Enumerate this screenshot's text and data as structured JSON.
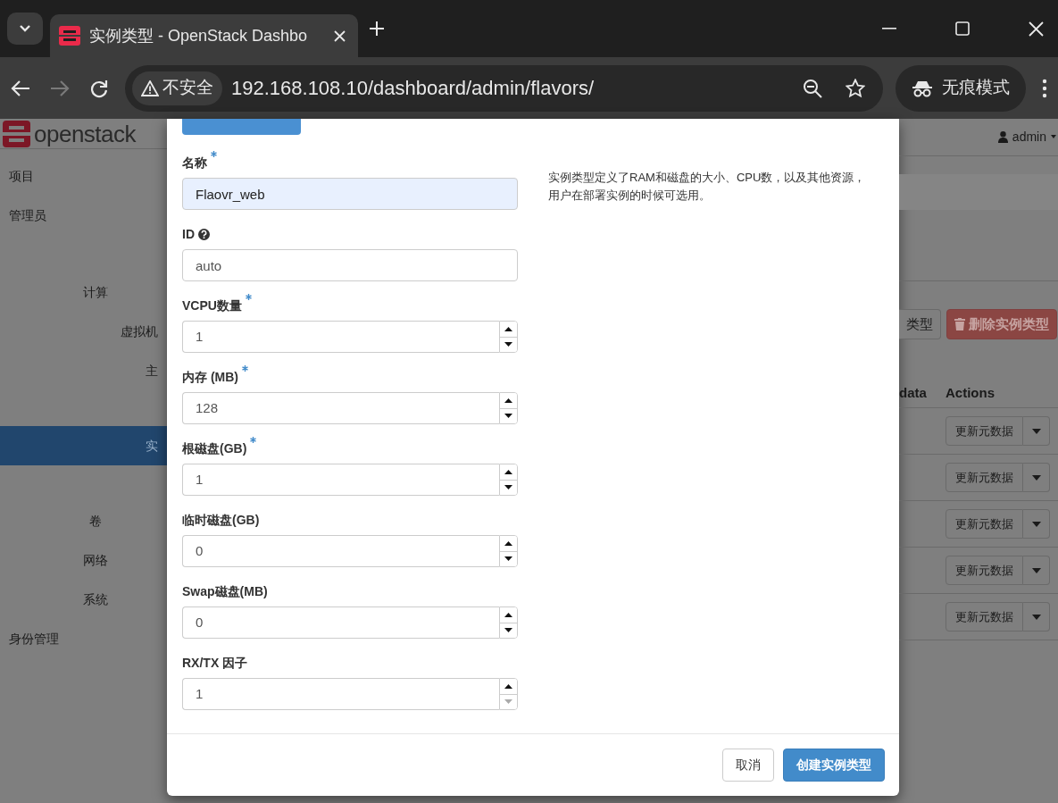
{
  "browser": {
    "tab_title": "实例类型 - OpenStack Dashbo",
    "security_label": "不安全",
    "url": "192.168.108.10/dashboard/admin/flavors/",
    "profile_label": "无痕模式",
    "forward_disabled": true
  },
  "header": {
    "logo_text": "openstack",
    "user": "admin"
  },
  "sidebar": {
    "items": [
      {
        "label": "项目",
        "selected": false
      },
      {
        "label": "管理员",
        "selected": false,
        "children": [
          {
            "label": "计算",
            "selected": false,
            "children": [
              {
                "label": "虚拟机",
                "selected": false
              },
              {
                "label": "主",
                "selected": false
              },
              {
                "label": "实",
                "selected": true
              }
            ]
          },
          {
            "label": "卷",
            "selected": false
          },
          {
            "label": "网络",
            "selected": false
          },
          {
            "label": "系统",
            "selected": false
          }
        ]
      },
      {
        "label": "身份管理",
        "selected": false
      }
    ]
  },
  "page_actions": [
    {
      "label": "类型",
      "kind": "default"
    },
    {
      "label": "删除实例类型",
      "kind": "danger"
    }
  ],
  "table": {
    "columns": [
      "data",
      "Actions"
    ],
    "rows": [
      {
        "action": "更新元数据"
      },
      {
        "action": "更新元数据"
      },
      {
        "action": "更新元数据"
      },
      {
        "action": "更新元数据"
      },
      {
        "action": "更新元数据"
      }
    ]
  },
  "modal": {
    "tabs": [
      {
        "selected": true
      }
    ],
    "fields": [
      {
        "label": "名称",
        "kind": "text",
        "required": true,
        "help": false,
        "value": "Flaovr_web",
        "autofilled": true
      },
      {
        "label": "ID",
        "kind": "text",
        "required": false,
        "help": true,
        "value": "auto",
        "autofilled": false
      },
      {
        "label": "VCPU数量",
        "kind": "number",
        "required": true,
        "help": false,
        "value": "1",
        "down_disabled": false
      },
      {
        "label": "内存 (MB)",
        "kind": "number",
        "required": true,
        "help": false,
        "value": "128",
        "down_disabled": false
      },
      {
        "label": "根磁盘(GB)",
        "kind": "number",
        "required": true,
        "help": false,
        "value": "1",
        "down_disabled": false
      },
      {
        "label": "临时磁盘(GB)",
        "kind": "number",
        "required": false,
        "help": false,
        "value": "0",
        "down_disabled": false
      },
      {
        "label": "Swap磁盘(MB)",
        "kind": "number",
        "required": false,
        "help": false,
        "value": "0",
        "down_disabled": false
      },
      {
        "label": "RX/TX 因子",
        "kind": "number",
        "required": false,
        "help": false,
        "value": "1",
        "down_disabled": true
      }
    ],
    "description": "实例类型定义了RAM和磁盘的大小、CPU数，以及其他资源，用户在部署实例的时候可选用。",
    "buttons": [
      {
        "label": "取消",
        "kind": "secondary"
      },
      {
        "label": "创建实例类型",
        "kind": "primary"
      }
    ]
  }
}
